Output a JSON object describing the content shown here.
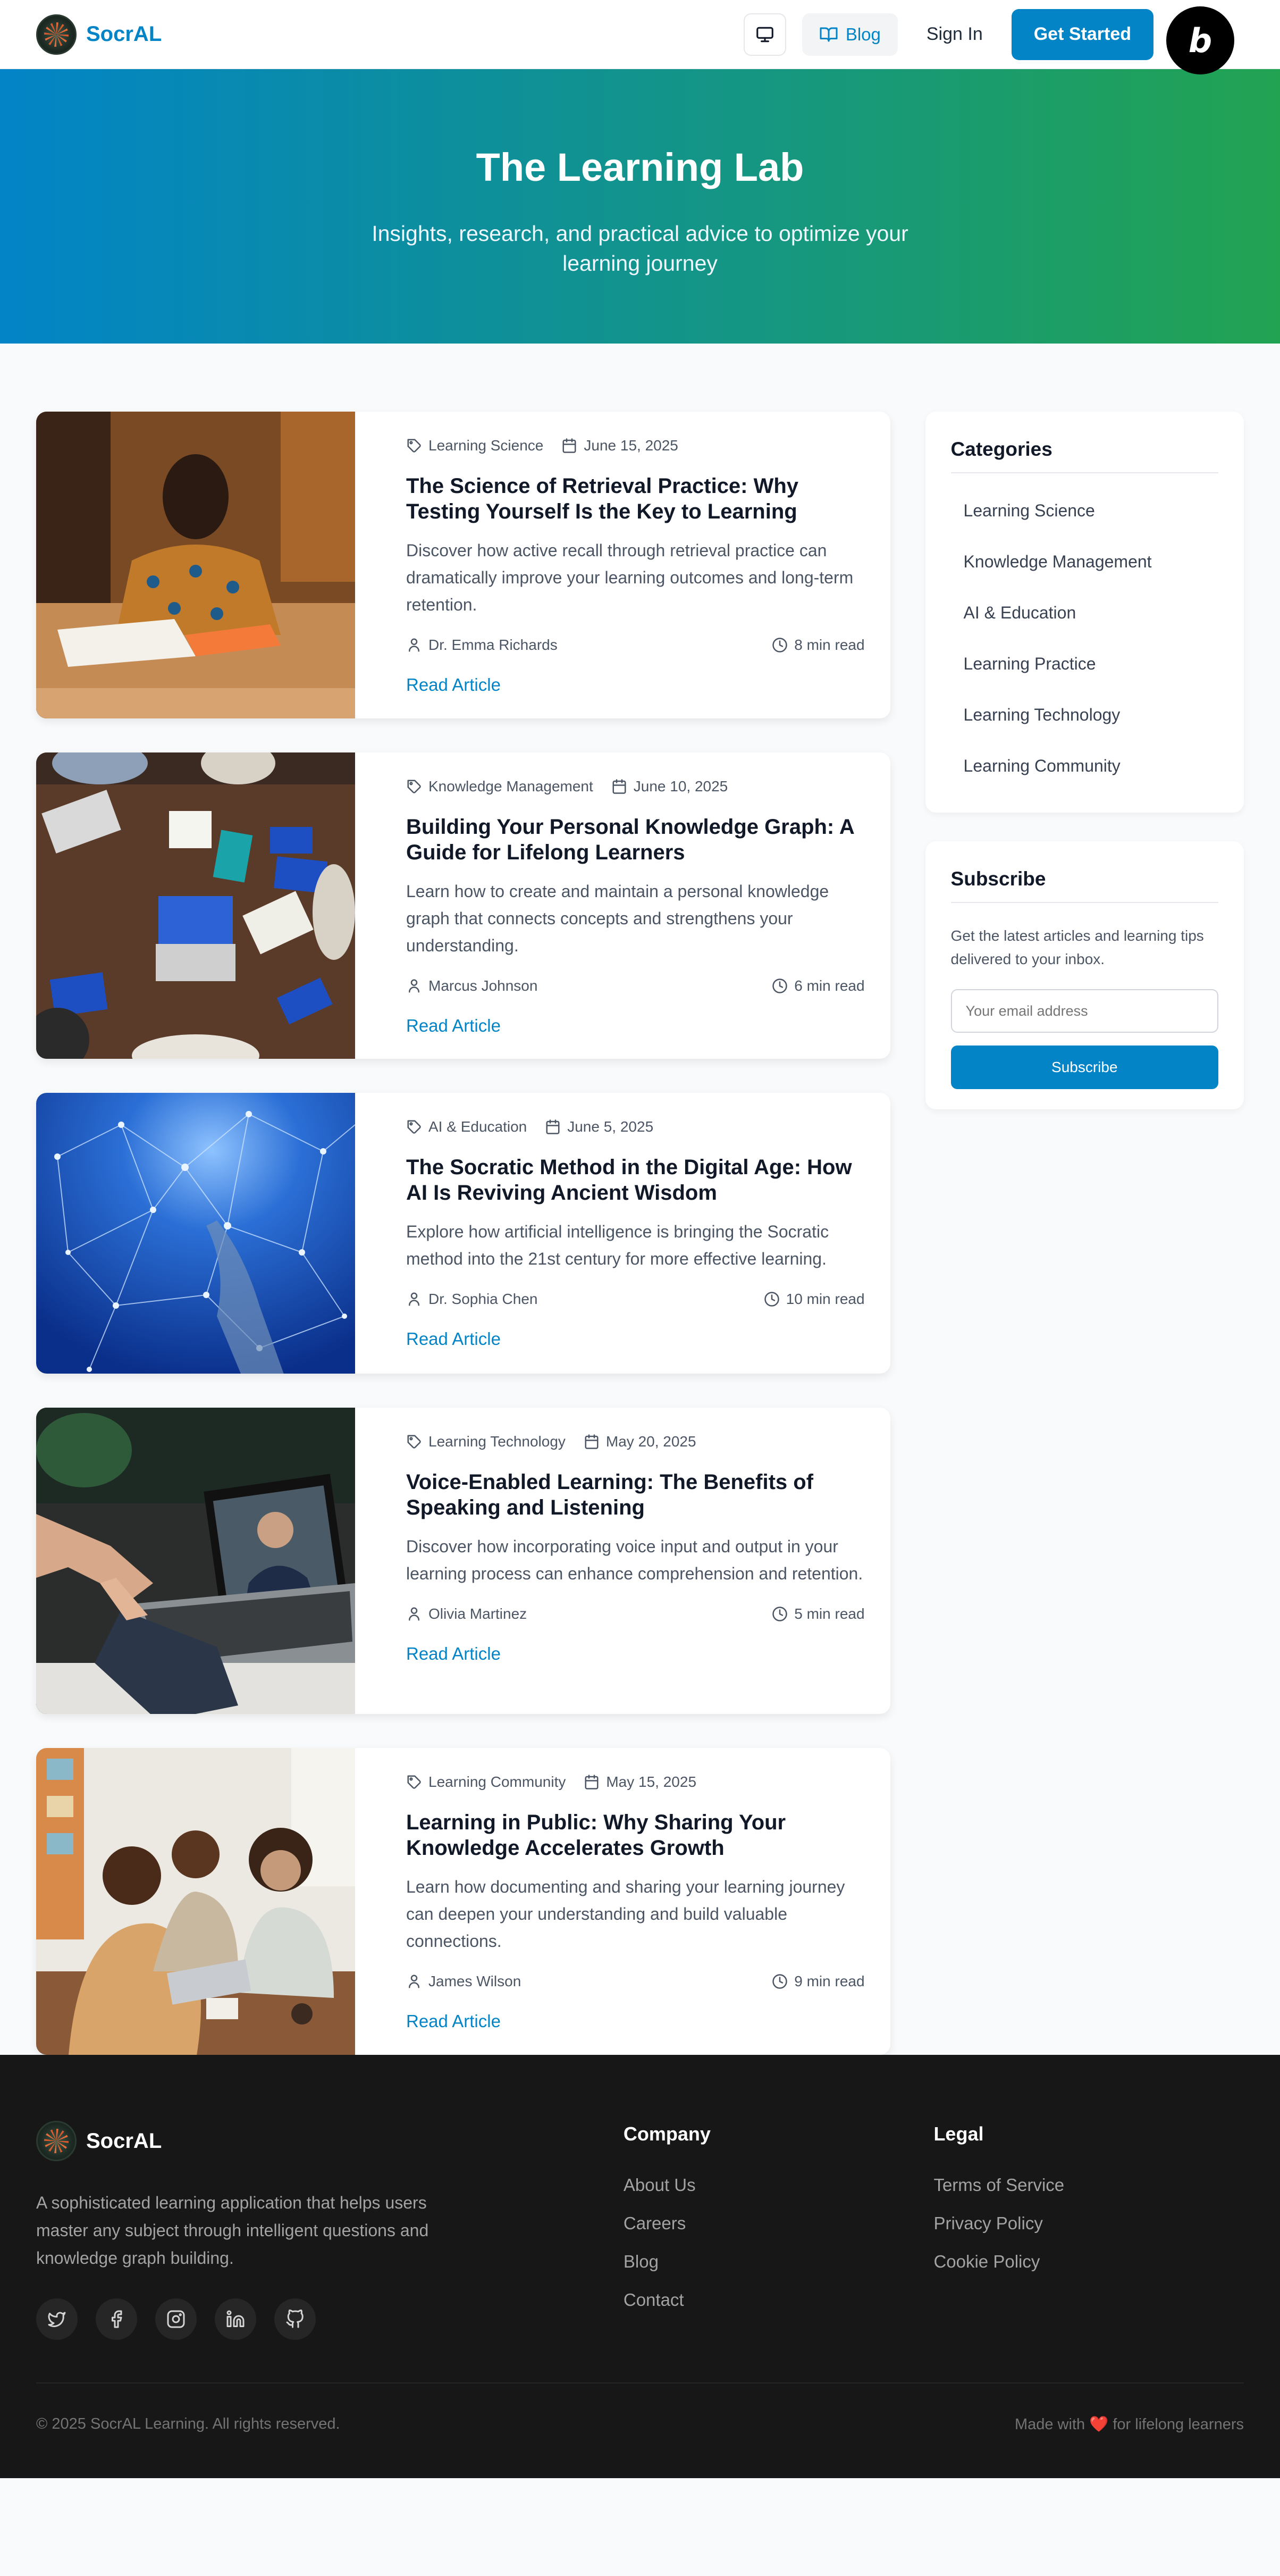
{
  "header": {
    "brand": "SocrAL",
    "nav_blog": "Blog",
    "sign_in": "Sign In",
    "get_started": "Get Started",
    "badge_letter": "b"
  },
  "hero": {
    "title": "The Learning Lab",
    "subtitle": "Insights, research, and practical advice to optimize your learning journey"
  },
  "articles": [
    {
      "category": "Learning Science",
      "date": "June 15, 2025",
      "title": "The Science of Retrieval Practice: Why Testing Yourself Is the Key to Learning",
      "excerpt": "Discover how active recall through retrieval practice can dramatically improve your learning outcomes and long-term retention.",
      "author": "Dr. Emma Richards",
      "read_time": "8 min read",
      "cta": "Read Article"
    },
    {
      "category": "Knowledge Management",
      "date": "June 10, 2025",
      "title": "Building Your Personal Knowledge Graph: A Guide for Lifelong Learners",
      "excerpt": "Learn how to create and maintain a personal knowledge graph that connects concepts and strengthens your understanding.",
      "author": "Marcus Johnson",
      "read_time": "6 min read",
      "cta": "Read Article"
    },
    {
      "category": "AI & Education",
      "date": "June 5, 2025",
      "title": "The Socratic Method in the Digital Age: How AI Is Reviving Ancient Wisdom",
      "excerpt": "Explore how artificial intelligence is bringing the Socratic method into the 21st century for more effective learning.",
      "author": "Dr. Sophia Chen",
      "read_time": "10 min read",
      "cta": "Read Article"
    },
    {
      "category": "Learning Technology",
      "date": "May 20, 2025",
      "title": "Voice-Enabled Learning: The Benefits of Speaking and Listening",
      "excerpt": "Discover how incorporating voice input and output in your learning process can enhance comprehension and retention.",
      "author": "Olivia Martinez",
      "read_time": "5 min read",
      "cta": "Read Article"
    },
    {
      "category": "Learning Community",
      "date": "May 15, 2025",
      "title": "Learning in Public: Why Sharing Your Knowledge Accelerates Growth",
      "excerpt": "Learn how documenting and sharing your learning journey can deepen your understanding and build valuable connections.",
      "author": "James Wilson",
      "read_time": "9 min read",
      "cta": "Read Article"
    }
  ],
  "sidebar": {
    "categories_title": "Categories",
    "categories": [
      "Learning Science",
      "Knowledge Management",
      "AI & Education",
      "Learning Practice",
      "Learning Technology",
      "Learning Community"
    ],
    "subscribe_title": "Subscribe",
    "subscribe_text": "Get the latest articles and learning tips delivered to your inbox.",
    "email_placeholder": "Your email address",
    "subscribe_button": "Subscribe"
  },
  "footer": {
    "brand": "SocrAL",
    "description": "A sophisticated learning application that helps users master any subject through intelligent questions and knowledge graph building.",
    "socials": [
      "twitter-icon",
      "facebook-icon",
      "instagram-icon",
      "linkedin-icon",
      "github-icon"
    ],
    "company_title": "Company",
    "company_links": [
      "About Us",
      "Careers",
      "Blog",
      "Contact"
    ],
    "legal_title": "Legal",
    "legal_links": [
      "Terms of Service",
      "Privacy Policy",
      "Cookie Policy"
    ],
    "copyright": "© 2025 SocrAL Learning. All rights reserved.",
    "made_with_prefix": "Made with",
    "made_with_heart": "❤️",
    "made_with_suffix": "for lifelong learners"
  },
  "colors": {
    "accent": "#0284c7",
    "hero_gradient_start": "#0284c7",
    "hero_gradient_end": "#22a352",
    "footer_bg": "#171717"
  }
}
